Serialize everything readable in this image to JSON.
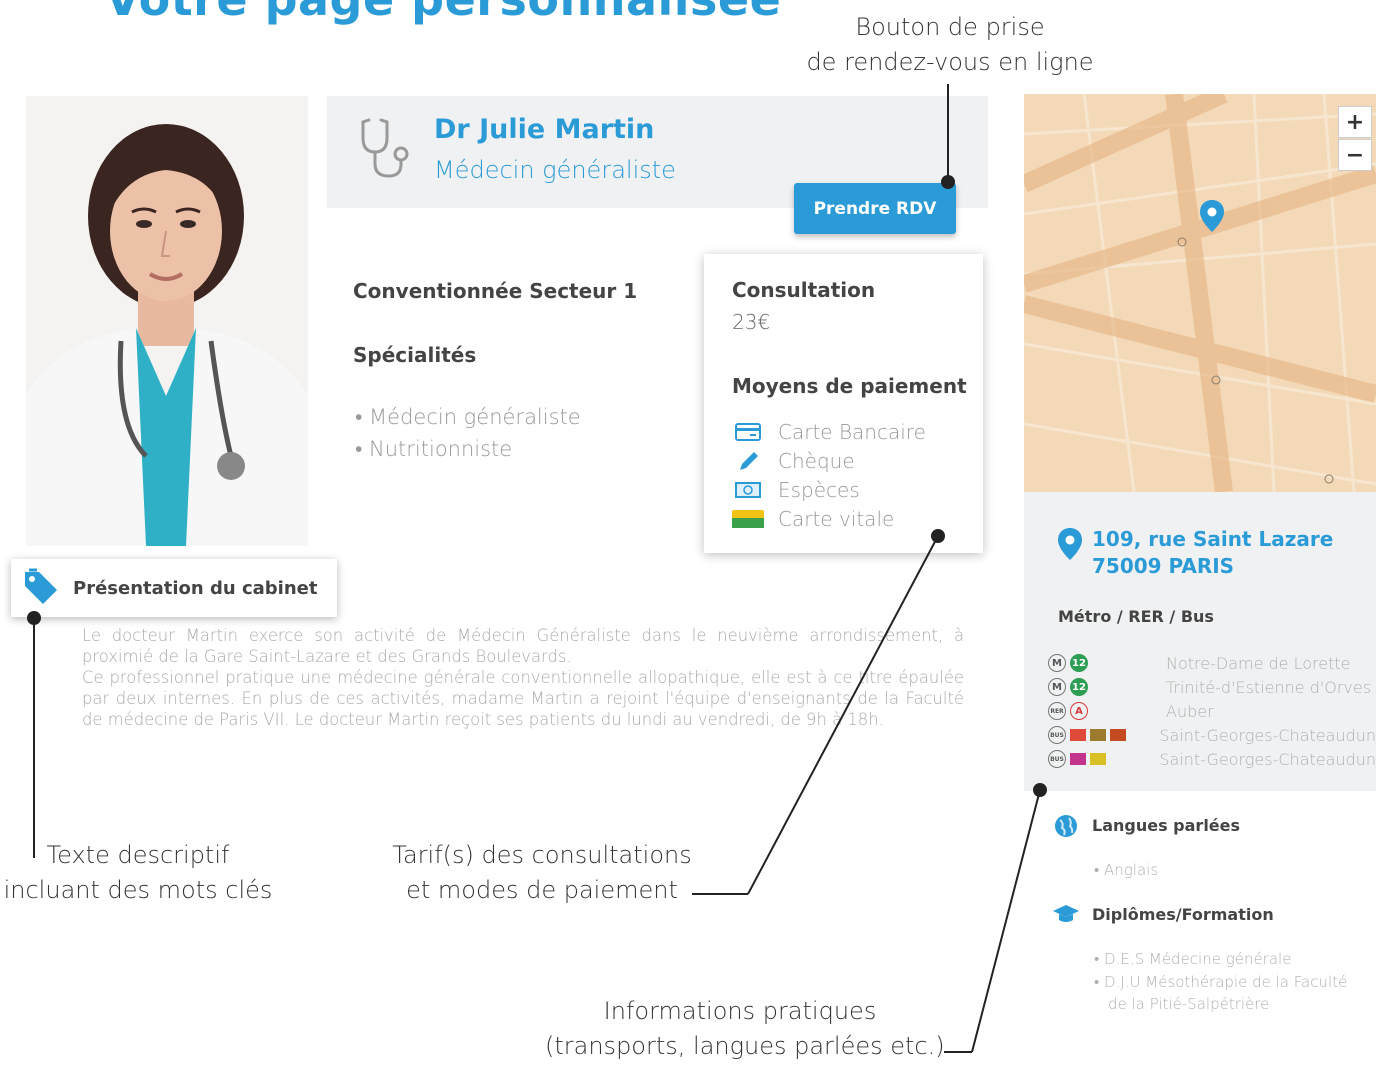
{
  "page": {
    "title": "Votre page personnalisée"
  },
  "doctor": {
    "name": "Dr Julie Martin",
    "title": "Médecin généraliste",
    "rdv_button": "Prendre RDV",
    "convention": "Conventionnée Secteur 1"
  },
  "specialities": {
    "heading": "Spécialités",
    "items": [
      "• Médecin généraliste",
      "• Nutritionniste"
    ]
  },
  "tarif": {
    "heading": "Consultation",
    "price": "23€",
    "payment_heading": "Moyens de paiement",
    "payments": [
      {
        "label": "Carte Bancaire",
        "icon": "credit-card-icon"
      },
      {
        "label": "Chèque",
        "icon": "pen-icon"
      },
      {
        "label": "Espèces",
        "icon": "banknote-icon"
      },
      {
        "label": "Carte vitale",
        "icon": "carte-vitale-icon"
      }
    ]
  },
  "presentation": {
    "tab_label": "Présentation du cabinet",
    "text": "Le docteur Martin exerce son activité de Médecin Généraliste dans le neuvième arrondissement, à proximié de la Gare Saint-Lazare et des Grands Boulevards.\nCe professionnel pratique une médecine générale conventionnelle allopathique, elle est à ce titre épaulée par deux internes. En plus de ces activités, madame Martin a rejoint l'équipe d'enseignants de la Faculté de médecine de Paris VII. Le docteur Martin reçoit ses patients du lundi au vendredi, de 9h à 18h."
  },
  "map": {
    "zoom_in": "+",
    "zoom_out": "−"
  },
  "address": {
    "line1": "109, rue Saint Lazare",
    "line2": "75009 PARIS"
  },
  "transport": {
    "heading": "Métro / RER / Bus",
    "stations": [
      {
        "label": "Notre-Dame de Lorette"
      },
      {
        "label": "Trinité-d'Estienne d'Orves"
      },
      {
        "label": "Auber"
      },
      {
        "label": "Saint-Georges-Chateaudun"
      },
      {
        "label": "Saint-Georges-Chateaudun"
      }
    ]
  },
  "languages": {
    "heading": "Langues parlées",
    "items": [
      "• Anglais"
    ]
  },
  "diplomas": {
    "heading": "Diplômes/Formation",
    "items": [
      "• D.E.S Médecine générale",
      "• D.J.U Mésothérapie de la Faculté",
      "de la Pitié-Salpétrière"
    ]
  },
  "annotations": {
    "rdv_line1": "Bouton de prise",
    "rdv_line2": "de rendez-vous en ligne",
    "desc_line1": "Texte descriptif",
    "desc_line2": "incluant des mots clés",
    "tarif_line1": "Tarif(s) des consultations",
    "tarif_line2": "et modes de paiement",
    "info_line1": "Informations pratiques",
    "info_line2": "(transports, langues parlées etc.)"
  },
  "colors": {
    "accent": "#2b9bd7",
    "panel": "#f0f1f2",
    "muted_text": "#aaaaaa"
  }
}
